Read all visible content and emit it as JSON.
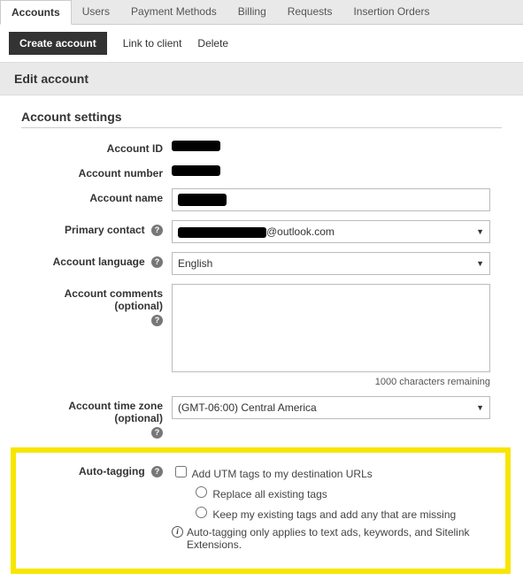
{
  "topTabs": {
    "accounts": "Accounts",
    "users": "Users",
    "payment": "Payment Methods",
    "billing": "Billing",
    "requests": "Requests",
    "insertion": "Insertion Orders"
  },
  "subActions": {
    "create": "Create account",
    "link": "Link to client",
    "delete": "Delete"
  },
  "header": "Edit account",
  "formTitle": "Account settings",
  "labels": {
    "accountId": "Account ID",
    "accountNumber": "Account number",
    "accountName": "Account name",
    "primaryContact": "Primary contact",
    "accountLanguage": "Account language",
    "accountComments": "Account comments (optional)",
    "accountTimezone": "Account time zone (optional)",
    "autoTagging": "Auto-tagging"
  },
  "values": {
    "contactSuffix": "@outlook.com",
    "language": "English",
    "timezone": "(GMT-06:00) Central America",
    "charsRemaining": "1000 characters remaining"
  },
  "autoTag": {
    "addUtm": "Add UTM tags to my destination URLs",
    "replace": "Replace all existing tags",
    "keep": "Keep my existing tags and add any that are missing",
    "note": "Auto-tagging only applies to text ads, keywords, and Sitelink Extensions."
  }
}
